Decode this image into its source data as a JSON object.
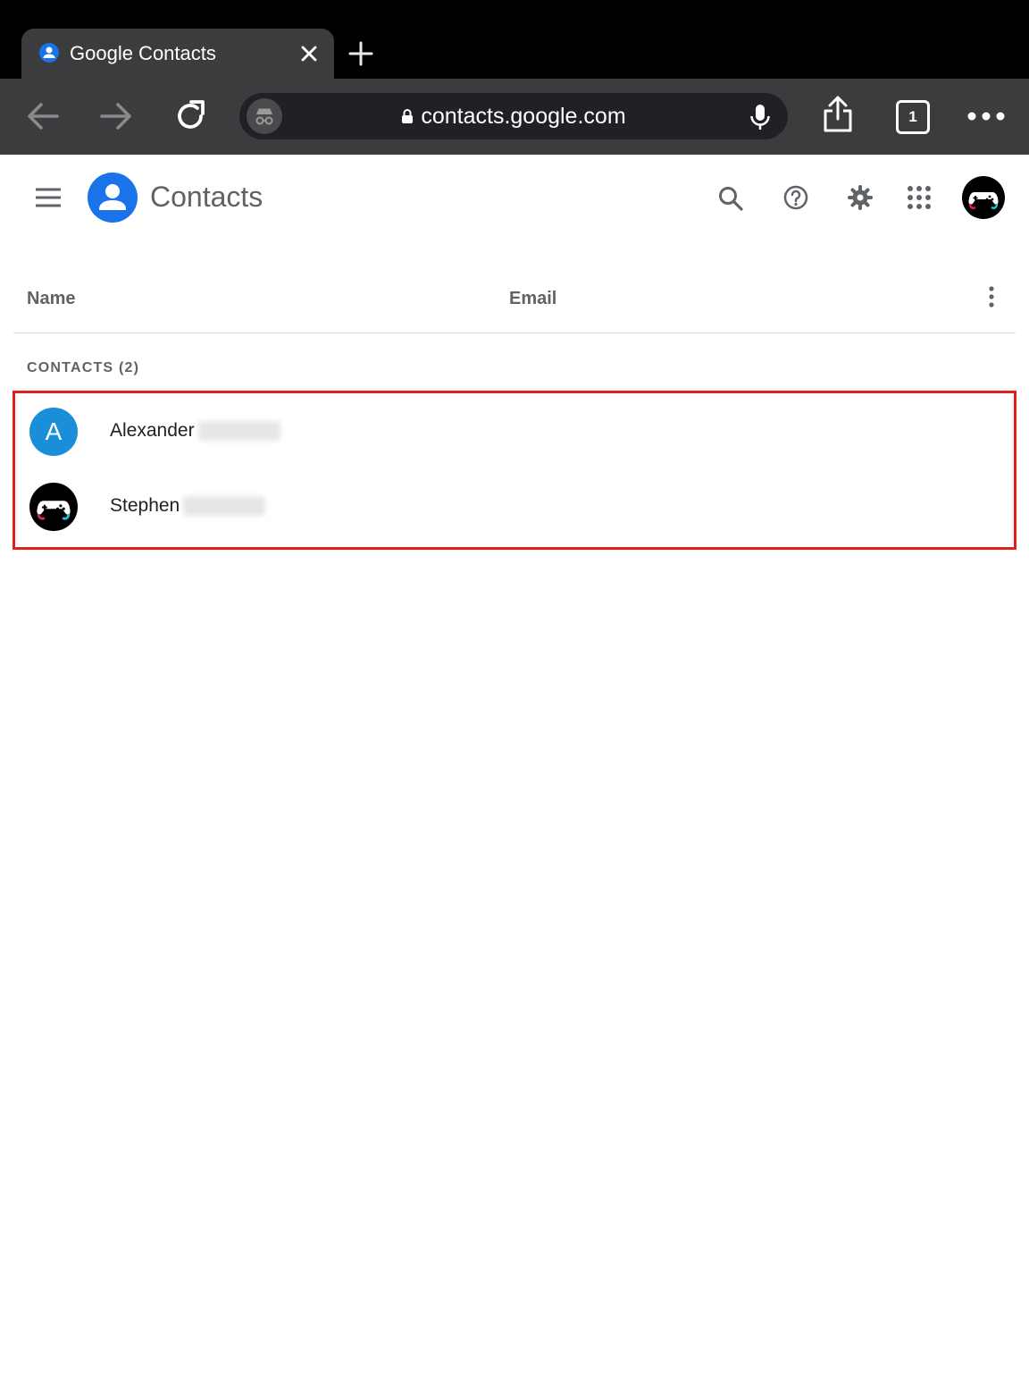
{
  "browser": {
    "tab": {
      "title": "Google Contacts",
      "favicon": "contacts-favicon-icon"
    },
    "url": "contacts.google.com",
    "tab_count": "1",
    "theme": {
      "chrome_bg": "#000000",
      "toolbar_bg": "#3c3c3e",
      "omnibox_bg": "#202124"
    }
  },
  "header": {
    "app_name": "Contacts",
    "logo_color": "#1a73e8",
    "icons": [
      "main-menu-icon",
      "search-icon",
      "help-icon",
      "settings-icon",
      "apps-grid-icon",
      "profile-avatar"
    ]
  },
  "list": {
    "columns": [
      "Name",
      "Email"
    ],
    "section_label": "CONTACTS (2)",
    "contacts": [
      {
        "name": "Alexander",
        "initial": "A",
        "avatar_color": "#1a8ed8"
      },
      {
        "name": "Stephen",
        "avatar": "gamepad-avatar-icon"
      }
    ],
    "highlight_color": "#e0201a"
  }
}
